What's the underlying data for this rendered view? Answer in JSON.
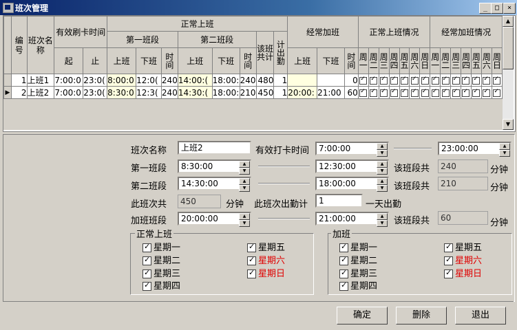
{
  "window": {
    "title": "班次管理"
  },
  "grid": {
    "headers": {
      "no": "编号",
      "name": "班次名称",
      "valid": "有效刷卡时间",
      "valid_start": "起",
      "valid_end": "止",
      "normal": "正常上班",
      "seg1": "第一班段",
      "seg2": "第二班段",
      "on": "上班",
      "off": "下班",
      "time": "时间",
      "total": "该班共计",
      "count": "计出勤",
      "overtime": "经常加班",
      "normal_days": "正常上班情况",
      "ot_days": "经常加班情况",
      "days": [
        "周一",
        "周二",
        "周三",
        "周四",
        "周五",
        "周六",
        "周日"
      ]
    },
    "rows": [
      {
        "no": "1",
        "name": "上班1",
        "vs": "7:00:0",
        "ve": "23:0(",
        "s1on": "8:00:0",
        "s1off": "12:0(",
        "s1t": "240",
        "s2on": "14:00:(",
        "s2off": "18:00:",
        "s2t": "240",
        "total": "480",
        "count": "1",
        "oton": "",
        "otoff": "",
        "ott": "0"
      },
      {
        "no": "2",
        "name": "上班2",
        "vs": "7:00:0",
        "ve": "23:0(",
        "s1on": "8:30:0",
        "s1off": "12:3(",
        "s1t": "240",
        "s2on": "14:30:(",
        "s2off": "18:00:",
        "s2t": "210",
        "total": "450",
        "count": "1",
        "oton": "20:00:",
        "otoff": "21:00",
        "ott": "60"
      }
    ]
  },
  "form": {
    "name_label": "班次名称",
    "name_value": "上班2",
    "valid_label": "有效打卡时间",
    "valid_start": "7:00:00",
    "valid_end": "23:00:00",
    "seg1_label": "第一班段",
    "seg1_on": "8:30:00",
    "seg1_off": "12:30:00",
    "seg1_total_label": "该班段共",
    "seg1_total": "240",
    "unit": "分钟",
    "seg2_label": "第二班段",
    "seg2_on": "14:30:00",
    "seg2_off": "18:00:00",
    "seg2_total_label": "该班段共",
    "seg2_total": "210",
    "shift_total_label": "此班次共",
    "shift_total": "450",
    "count_label": "此班次出勤计",
    "count_value": "1",
    "count_suffix": "一天出勤",
    "ot_label": "加班班段",
    "ot_on": "20:00:00",
    "ot_off": "21:00:00",
    "ot_total_label": "该班段共",
    "ot_total": "60"
  },
  "normal_group": {
    "title": "正常上班",
    "days": [
      "星期一",
      "星期二",
      "星期三",
      "星期四",
      "星期五",
      "星期六",
      "星期日"
    ]
  },
  "ot_group": {
    "title": "加班",
    "days": [
      "星期一",
      "星期二",
      "星期三",
      "星期四",
      "星期五",
      "星期六",
      "星期日"
    ]
  },
  "buttons": {
    "ok": "确定",
    "delete": "删除",
    "exit": "退出"
  },
  "colors": {
    "titlebar": "#0a246a",
    "weekend": "#e00000",
    "highlight": "#ffffe0"
  }
}
